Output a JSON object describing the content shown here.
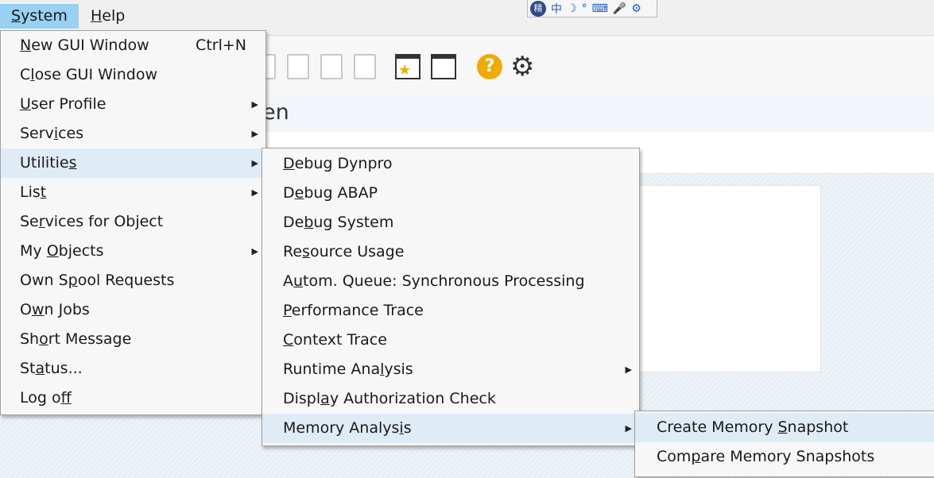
{
  "menubar": {
    "system": {
      "pre": "",
      "acc": "S",
      "post": "ystem"
    },
    "help": {
      "pre": "",
      "acc": "H",
      "post": "elp"
    }
  },
  "ime": {
    "logo": "精",
    "zh": "中",
    "moon": "☽",
    "dot": "°",
    "keyboard": "⌨",
    "mic": "🎤",
    "gear": "⚙"
  },
  "toolbar": {
    "help": "?",
    "settings": "⚙",
    "star": "★"
  },
  "screen_title_fragment": "en",
  "system_menu": [
    {
      "pre": "",
      "acc": "N",
      "post": "ew GUI Window",
      "shortcut": "Ctrl+N",
      "sub": false
    },
    {
      "pre": "C",
      "acc": "l",
      "post": "ose GUI Window",
      "shortcut": "",
      "sub": false
    },
    {
      "pre": "",
      "acc": "U",
      "post": "ser Profile",
      "shortcut": "",
      "sub": true
    },
    {
      "pre": "Serv",
      "acc": "i",
      "post": "ces",
      "shortcut": "",
      "sub": true
    },
    {
      "pre": "Utilitie",
      "acc": "s",
      "post": "",
      "shortcut": "",
      "sub": true,
      "highlighted": true
    },
    {
      "pre": "Lis",
      "acc": "t",
      "post": "",
      "shortcut": "",
      "sub": true
    },
    {
      "pre": "Se",
      "acc": "r",
      "post": "vices for Object",
      "shortcut": "",
      "sub": false
    },
    {
      "pre": "My ",
      "acc": "O",
      "post": "bjects",
      "shortcut": "",
      "sub": true
    },
    {
      "pre": "Own S",
      "acc": "p",
      "post": "ool Requests",
      "shortcut": "",
      "sub": false
    },
    {
      "pre": "O",
      "acc": "w",
      "post": "n Jobs",
      "shortcut": "",
      "sub": false
    },
    {
      "pre": "Sh",
      "acc": "o",
      "post": "rt Message",
      "shortcut": "",
      "sub": false
    },
    {
      "pre": "St",
      "acc": "a",
      "post": "tus...",
      "shortcut": "",
      "sub": false
    },
    {
      "pre": "Log o",
      "acc": "f",
      "post": "f",
      "shortcut": "",
      "sub": false
    }
  ],
  "utilities_menu": [
    {
      "pre": "",
      "acc": "D",
      "post": "ebug Dynpro",
      "sub": false
    },
    {
      "pre": "D",
      "acc": "e",
      "post": "bug ABAP",
      "sub": false
    },
    {
      "pre": "De",
      "acc": "b",
      "post": "ug System",
      "sub": false
    },
    {
      "pre": "Re",
      "acc": "s",
      "post": "ource Usage",
      "sub": false
    },
    {
      "pre": "A",
      "acc": "u",
      "post": "tom. Queue: Synchronous Processing",
      "sub": false
    },
    {
      "pre": "",
      "acc": "P",
      "post": "erformance Trace",
      "sub": false
    },
    {
      "pre": "",
      "acc": "C",
      "post": "ontext Trace",
      "sub": false
    },
    {
      "pre": "Runtime Ana",
      "acc": "l",
      "post": "ysis",
      "sub": true
    },
    {
      "pre": "Displ",
      "acc": "a",
      "post": "y Authorization Check",
      "sub": false
    },
    {
      "pre": "Memory Analys",
      "acc": "i",
      "post": "s",
      "sub": true,
      "highlighted": true
    }
  ],
  "memory_menu": [
    {
      "pre": "Create Memory ",
      "acc": "S",
      "post": "napshot",
      "highlighted": true
    },
    {
      "pre": "Com",
      "acc": "p",
      "post": "are Memory Snapshots",
      "highlighted": false
    }
  ],
  "submenu_arrow": "▶"
}
